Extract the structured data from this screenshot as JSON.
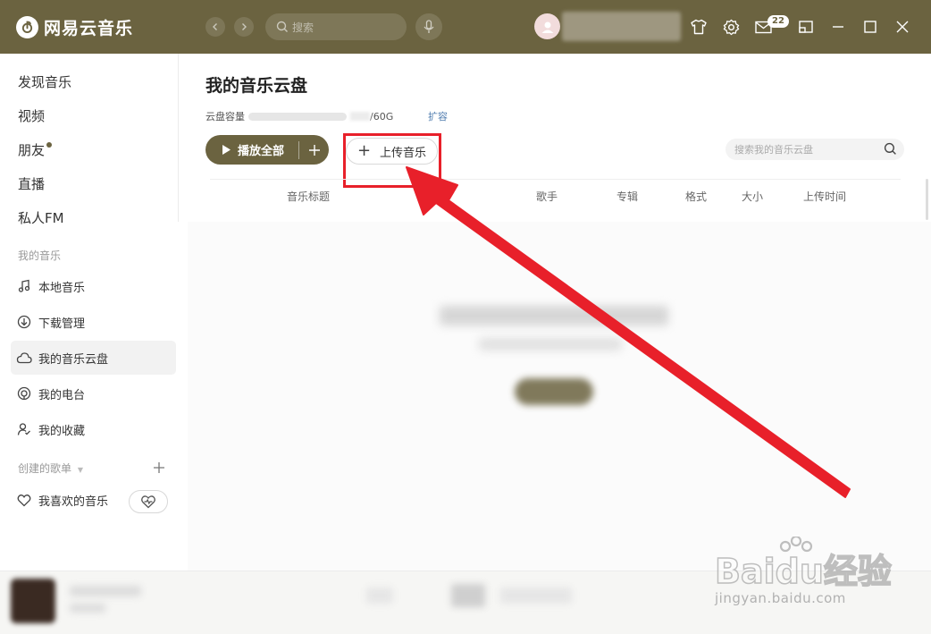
{
  "app": {
    "name": "网易云音乐",
    "search_placeholder": "搜索",
    "mail_badge": "22"
  },
  "sidebar": {
    "main_items": [
      {
        "label": "发现音乐"
      },
      {
        "label": "视频"
      },
      {
        "label": "朋友"
      },
      {
        "label": "直播"
      },
      {
        "label": "私人FM"
      }
    ],
    "my_music_title": "我的音乐",
    "my_music_items": [
      {
        "label": "本地音乐",
        "icon": "music-note-icon"
      },
      {
        "label": "下载管理",
        "icon": "download-icon"
      },
      {
        "label": "我的音乐云盘",
        "icon": "cloud-icon"
      },
      {
        "label": "我的电台",
        "icon": "radio-icon"
      },
      {
        "label": "我的收藏",
        "icon": "collection-icon"
      }
    ],
    "created_playlists_title": "创建的歌单",
    "playlists": [
      {
        "label": "我喜欢的音乐",
        "icon": "heart-icon"
      }
    ]
  },
  "main": {
    "title": "我的音乐云盘",
    "capacity_label": "云盘容量",
    "capacity_total": "/60G",
    "expand_link": "扩容",
    "play_all_label": "播放全部",
    "upload_label": "上传音乐",
    "cloud_search_placeholder": "搜索我的音乐云盘",
    "columns": [
      "音乐标题",
      "歌手",
      "专辑",
      "格式",
      "大小",
      "上传时间"
    ]
  },
  "watermark": {
    "brand": "Baidu经验",
    "url": "jingyan.baidu.com"
  },
  "colors": {
    "theme": "#6b6340",
    "annotation_red": "#e8202a",
    "link": "#507daf"
  }
}
